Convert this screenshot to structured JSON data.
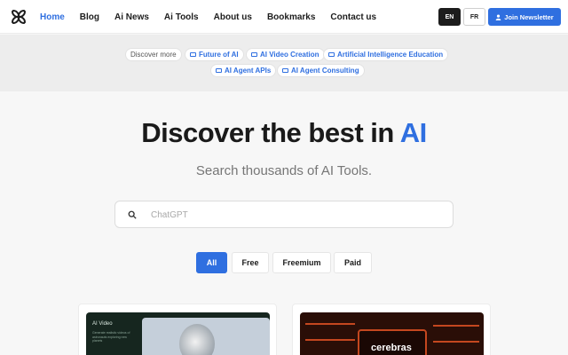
{
  "header": {
    "nav": [
      {
        "label": "Home",
        "active": true
      },
      {
        "label": "Blog"
      },
      {
        "label": "Ai News"
      },
      {
        "label": "Ai Tools"
      },
      {
        "label": "About us"
      },
      {
        "label": "Bookmarks"
      },
      {
        "label": "Contact us"
      }
    ],
    "lang_en": "EN",
    "lang_fr": "FR",
    "newsletter": "Join Newsletter"
  },
  "discover": {
    "label": "Discover more",
    "links": [
      "Future of AI",
      "AI Video Creation",
      "Artificial Intelligence Education",
      "AI Agent APIs",
      "AI Agent Consulting"
    ]
  },
  "hero": {
    "title_main": "Discover the best in ",
    "title_accent": "AI",
    "subtitle": "Search thousands of AI Tools."
  },
  "search": {
    "placeholder": "ChatGPT"
  },
  "filters": [
    "All",
    "Free",
    "Freemium",
    "Paid"
  ],
  "cards": {
    "card1_label": "AI Video",
    "card1_text": "Generate realistic videos of astronauts exploring new planets",
    "card2_brand": "cerebras"
  },
  "colors": {
    "accent": "#2f6fe0",
    "dark": "#1c1c1c"
  }
}
